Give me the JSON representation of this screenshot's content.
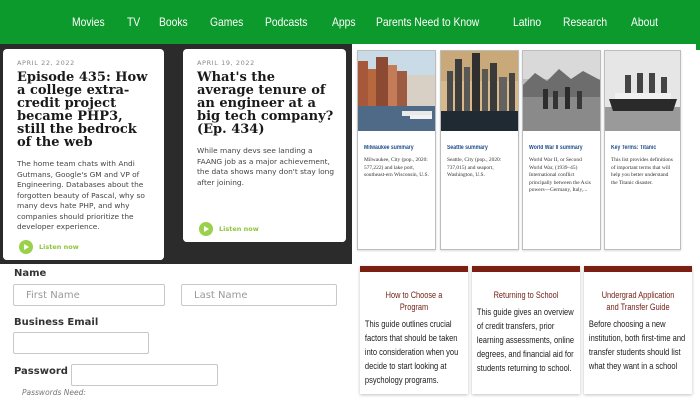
{
  "nav": {
    "items": [
      "Movies",
      "TV",
      "Books",
      "Games",
      "Podcasts",
      "Apps",
      "Parents Need to Know",
      "Latino",
      "Research",
      "About"
    ]
  },
  "podcasts": [
    {
      "date": "APRIL 22, 2022",
      "title": "Episode 435: How a college extra-credit project became PHP3, still the bedrock of the web",
      "description": "The home team chats with Andi Gutmans, Google's GM and VP of Engineering. Databases about the forgotten beauty of Pascal, why so many devs hate PHP, and why companies should prioritize the developer experience.",
      "listen": "Listen now"
    },
    {
      "date": "APRIL 19, 2022",
      "title": "What's the average tenure of an engineer at a big tech company? (Ep. 434)",
      "description": "While many devs see landing a FAANG job as a major achievement, the data shows many don't stay long after joining.",
      "listen": "Listen now"
    }
  ],
  "summaries": [
    {
      "title": "Milwaukee summary",
      "description": "Milwaukee, City (pop., 2020: 577,222) and lake port, southeast-ern Wisconsin, U.S."
    },
    {
      "title": "Seattle summary",
      "description": "Seattle, City (pop., 2020: 737,015) and seaport, Washington, U.S."
    },
    {
      "title": "World War II summary",
      "description": "World War II, or Second World War, (1939–45) International conflict principally between the Axis powers—Germany, Italy,..."
    },
    {
      "title": "Key Terms: Titanic",
      "description": "This list provides definitions of important terms that will help you better understand the Titanic disaster."
    }
  ],
  "guides": [
    {
      "title": "How to Choose a Program",
      "description": "This guide outlines crucial factors that should be taken into consideration when you decide to start looking at psychology programs."
    },
    {
      "title": "Returning to School",
      "description": "This guide gives an overview of credit transfers, prior learning assessments, online degrees, and financial aid for students returning to school."
    },
    {
      "title": "Undergrad Application and Transfer Guide",
      "description": "Before choosing a new institution, both first-time and transfer students should list what they want in a school"
    }
  ],
  "form": {
    "name_label": "Name",
    "first_placeholder": "First Name",
    "last_placeholder": "Last Name",
    "email_label": "Business Email",
    "password_label": "Password",
    "password_hint": "Passwords Need:"
  },
  "colors": {
    "nav_bg": "#0b9a2b",
    "guide_accent": "#7a1f12",
    "summary_title": "#1f4d8a",
    "podcast_bg": "#2b2b2b",
    "listen_green": "#8fc43c"
  }
}
